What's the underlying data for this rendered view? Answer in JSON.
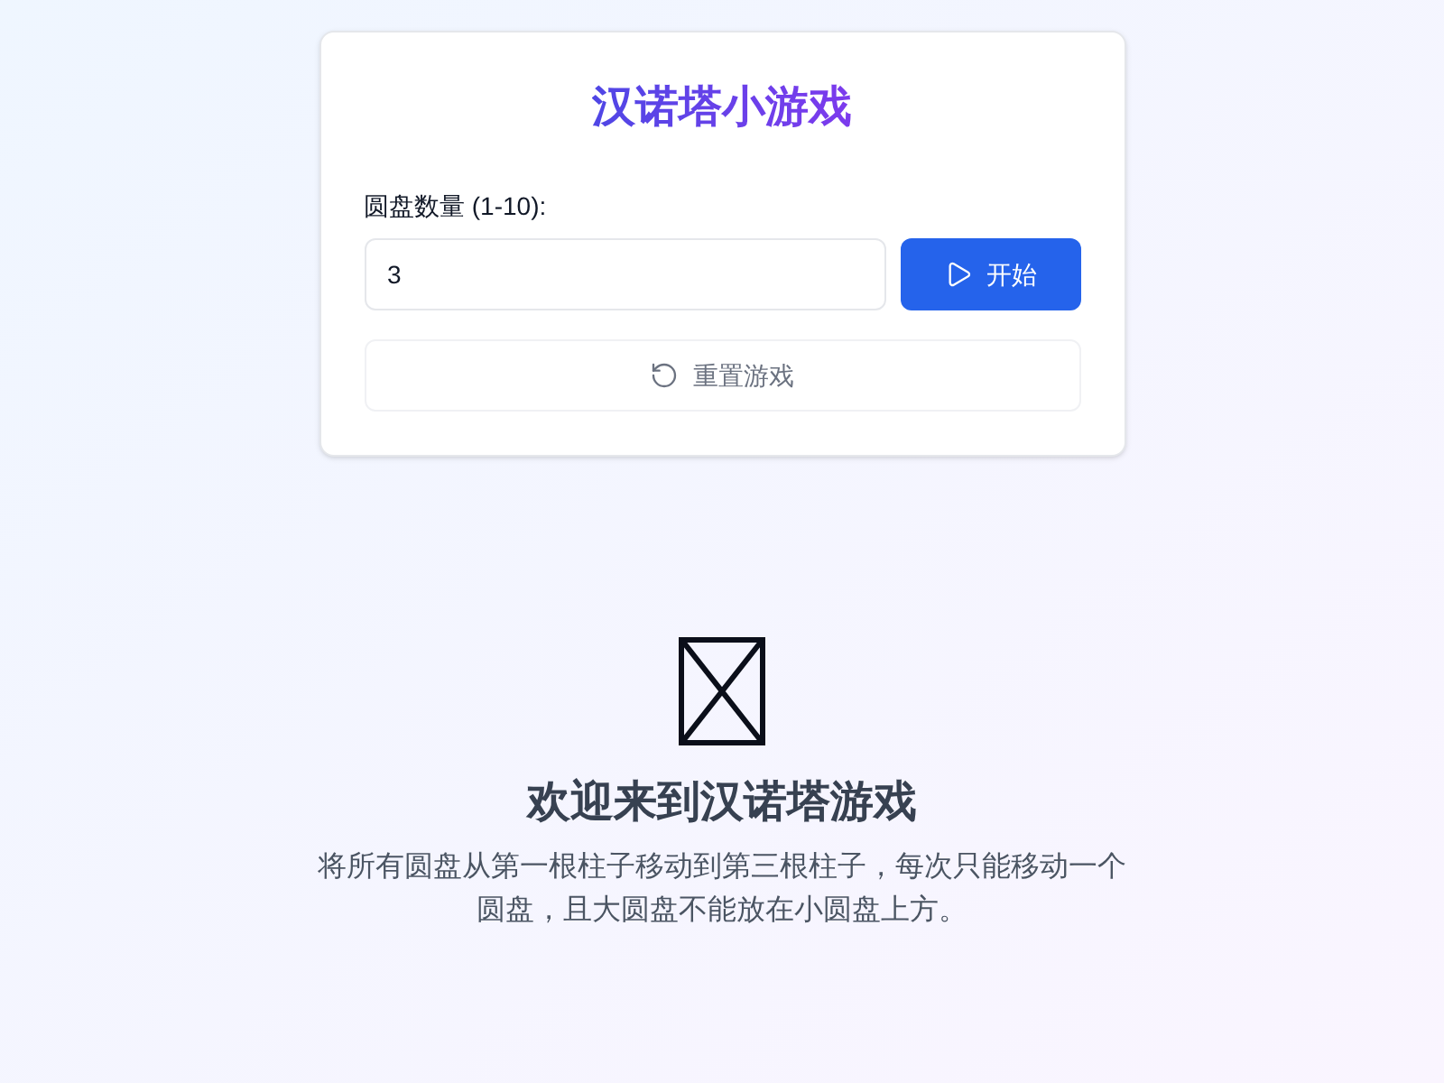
{
  "title": "汉诺塔小游戏",
  "disk_count": {
    "label": "圆盘数量 (1-10):",
    "value": "3"
  },
  "start_button": {
    "label": "开始"
  },
  "reset_button": {
    "label": "重置游戏",
    "disabled": true
  },
  "welcome": {
    "heading": "欢迎来到汉诺塔游戏",
    "text": "将所有圆盘从第一根柱子移动到第三根柱子，每次只能移动一个圆盘，且大圆盘不能放在小圆盘上方。"
  }
}
